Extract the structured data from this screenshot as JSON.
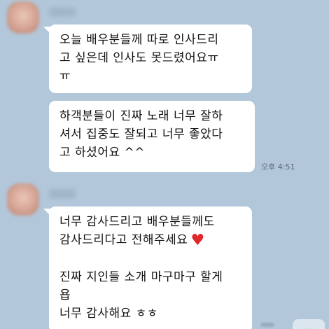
{
  "chat": {
    "messages": [
      {
        "lines": [
          "오늘 배우분들께 따로 인사드리",
          "고 싶은데 인사도 못드렸어요ㅠ",
          "ㅠ"
        ]
      },
      {
        "lines": [
          "하객분들이 진짜 노래 너무 잘하",
          "셔서 집중도 잘되고 너무 좋았다",
          "고 하셨어요 ^^"
        ],
        "time": "오후 4:51"
      },
      {
        "lines": [
          "너무 감사드리고 배우분들께도",
          "감사드리다고 전해주세요",
          "",
          "진짜 지인들 소개 마구마구 할게",
          "욥",
          "너무 감사해요 ㅎㅎ"
        ],
        "heart": "♥"
      }
    ],
    "scroll_button_icon": "chevron-down-icon",
    "scroll_button_glyph": "⌄"
  },
  "colors": {
    "background": "#b2c7da",
    "bubble": "#ffffff",
    "heart": "#e0282c"
  }
}
